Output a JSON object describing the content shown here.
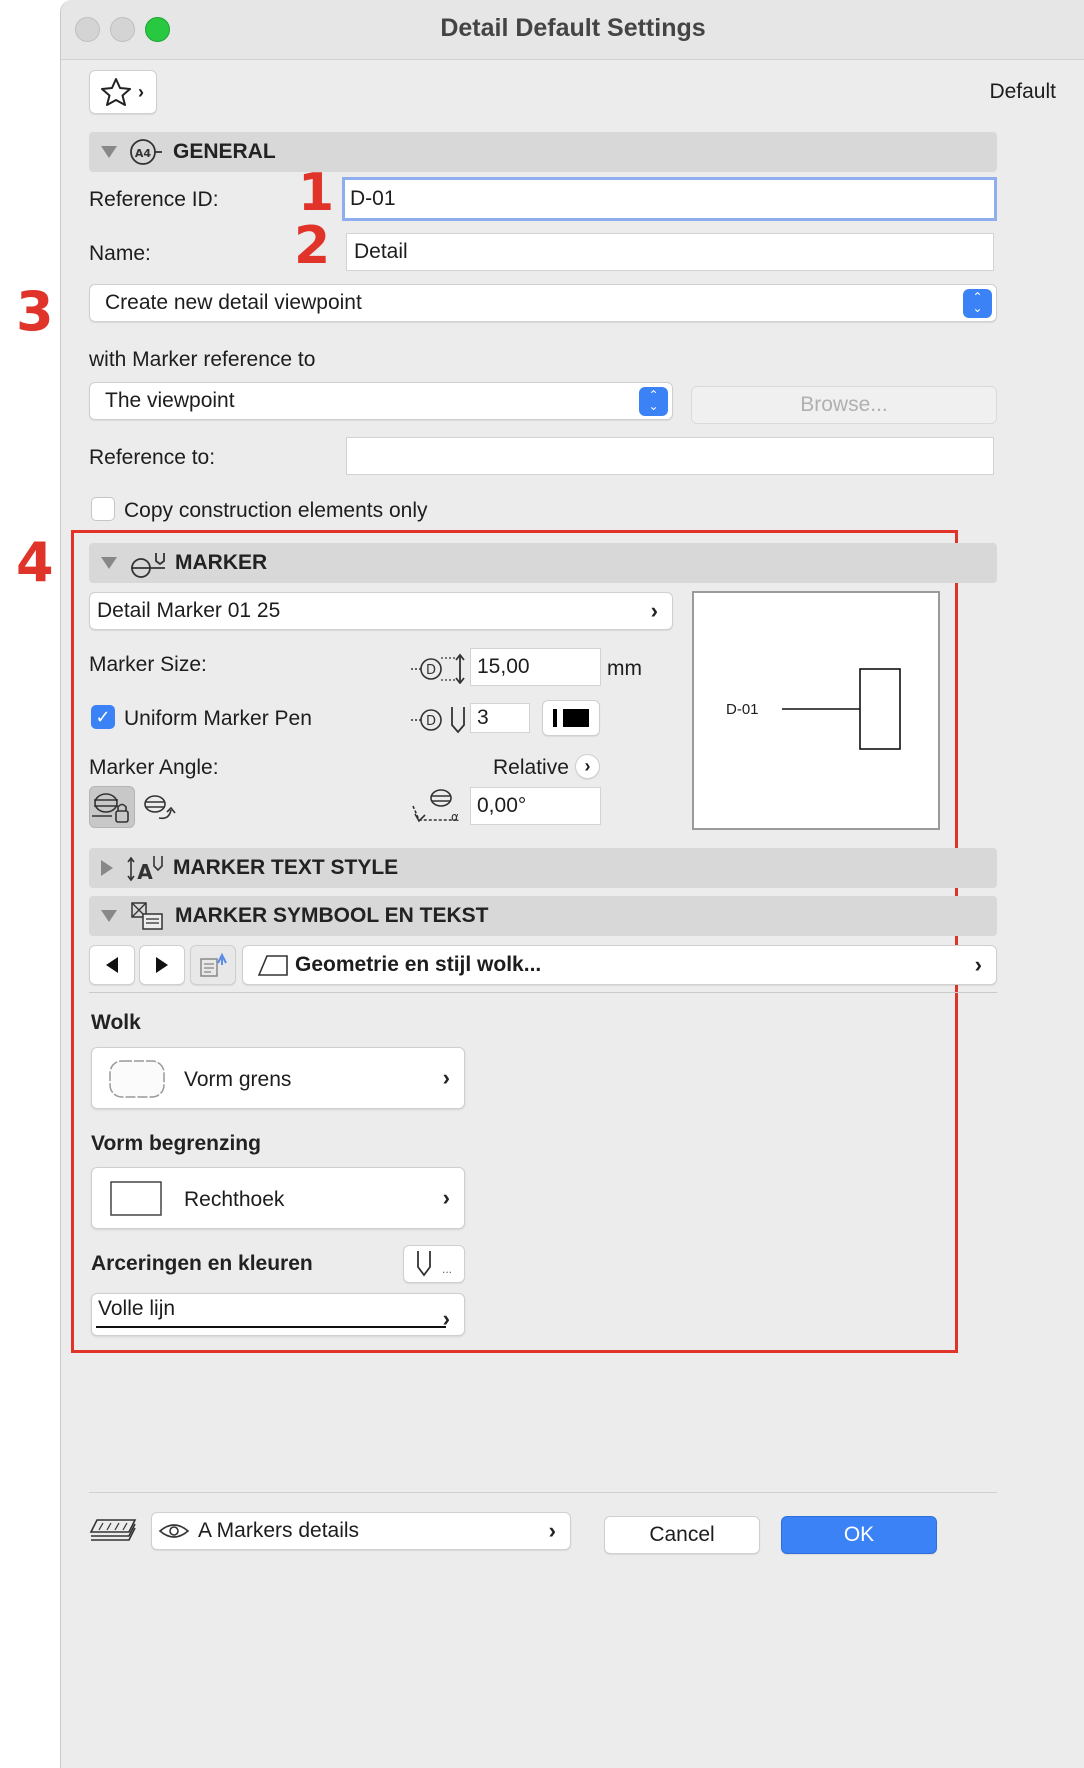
{
  "window": {
    "title": "Detail Default Settings"
  },
  "header": {
    "favorite_label": "Default"
  },
  "general": {
    "section_title": "GENERAL",
    "reference_id_label": "Reference ID:",
    "reference_id_value": "D-01",
    "name_label": "Name:",
    "name_value": "Detail",
    "mode_value": "Create new detail viewpoint",
    "marker_ref_label": "with Marker reference to",
    "marker_ref_value": "The viewpoint",
    "browse_label": "Browse...",
    "reference_to_label": "Reference to:",
    "reference_to_value": "",
    "copy_label": "Copy construction elements only"
  },
  "marker": {
    "section_title": "MARKER",
    "marker_type": "Detail Marker 01 25",
    "size_label": "Marker Size:",
    "size_value": "15,00",
    "size_unit": "mm",
    "uniform_pen_label": "Uniform Marker Pen",
    "pen_value": "3",
    "angle_label": "Marker Angle:",
    "relative_label": "Relative",
    "angle_value": "0,00°",
    "preview_label": "D-01"
  },
  "marker_text_style": {
    "section_title": "MARKER TEXT STYLE"
  },
  "marker_symbol": {
    "section_title": "MARKER SYMBOOL EN TEKST",
    "page_name": "Geometrie en stijl wolk...",
    "wolk_label": "Wolk",
    "wolk_value": "Vorm grens",
    "vorm_label": "Vorm begrenzing",
    "vorm_value": "Rechthoek",
    "arceringen_label": "Arceringen en kleuren",
    "pen_more": "...",
    "line_value": "Volle lijn"
  },
  "footer": {
    "layer_value": "A Markers details",
    "cancel_label": "Cancel",
    "ok_label": "OK"
  },
  "annotations": {
    "n1": "1",
    "n2": "2",
    "n3": "3",
    "n4": "4"
  },
  "colors": {
    "accent": "#3b82f6",
    "annotation": "#e0342a",
    "close": "#ff5f57",
    "green": "#28c840"
  }
}
